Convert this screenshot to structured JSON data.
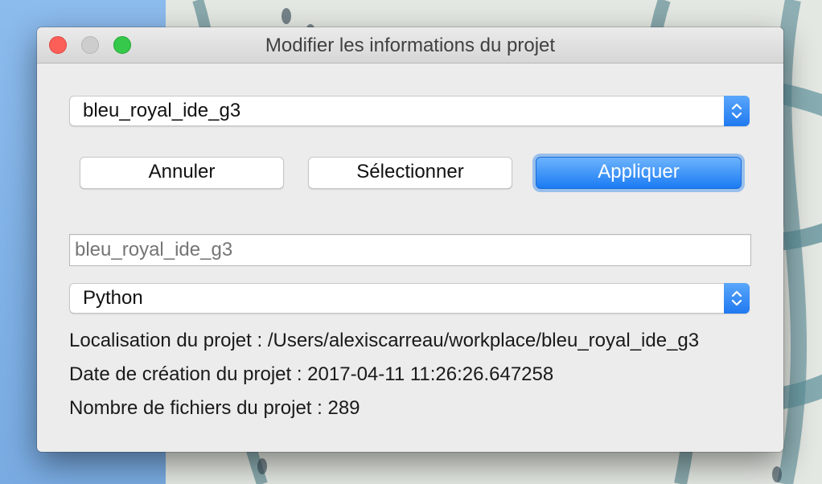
{
  "window": {
    "title": "Modifier les informations du projet"
  },
  "project_select": {
    "selected": "bleu_royal_ide_g3"
  },
  "buttons": {
    "cancel": "Annuler",
    "select": "Sélectionner",
    "apply": "Appliquer"
  },
  "name_field": {
    "placeholder": "bleu_royal_ide_g3"
  },
  "language_select": {
    "selected": "Python"
  },
  "info": {
    "location": "Localisation du projet : /Users/alexiscarreau/workplace/bleu_royal_ide_g3",
    "created": "Date de création du projet : 2017-04-11 11:26:26.647258",
    "file_count": "Nombre de fichiers du projet : 289"
  },
  "colors": {
    "accent": "#1b7bf3",
    "close": "#fc5f57",
    "minimize_disabled": "#cdcdcd",
    "zoom": "#35c84a"
  }
}
